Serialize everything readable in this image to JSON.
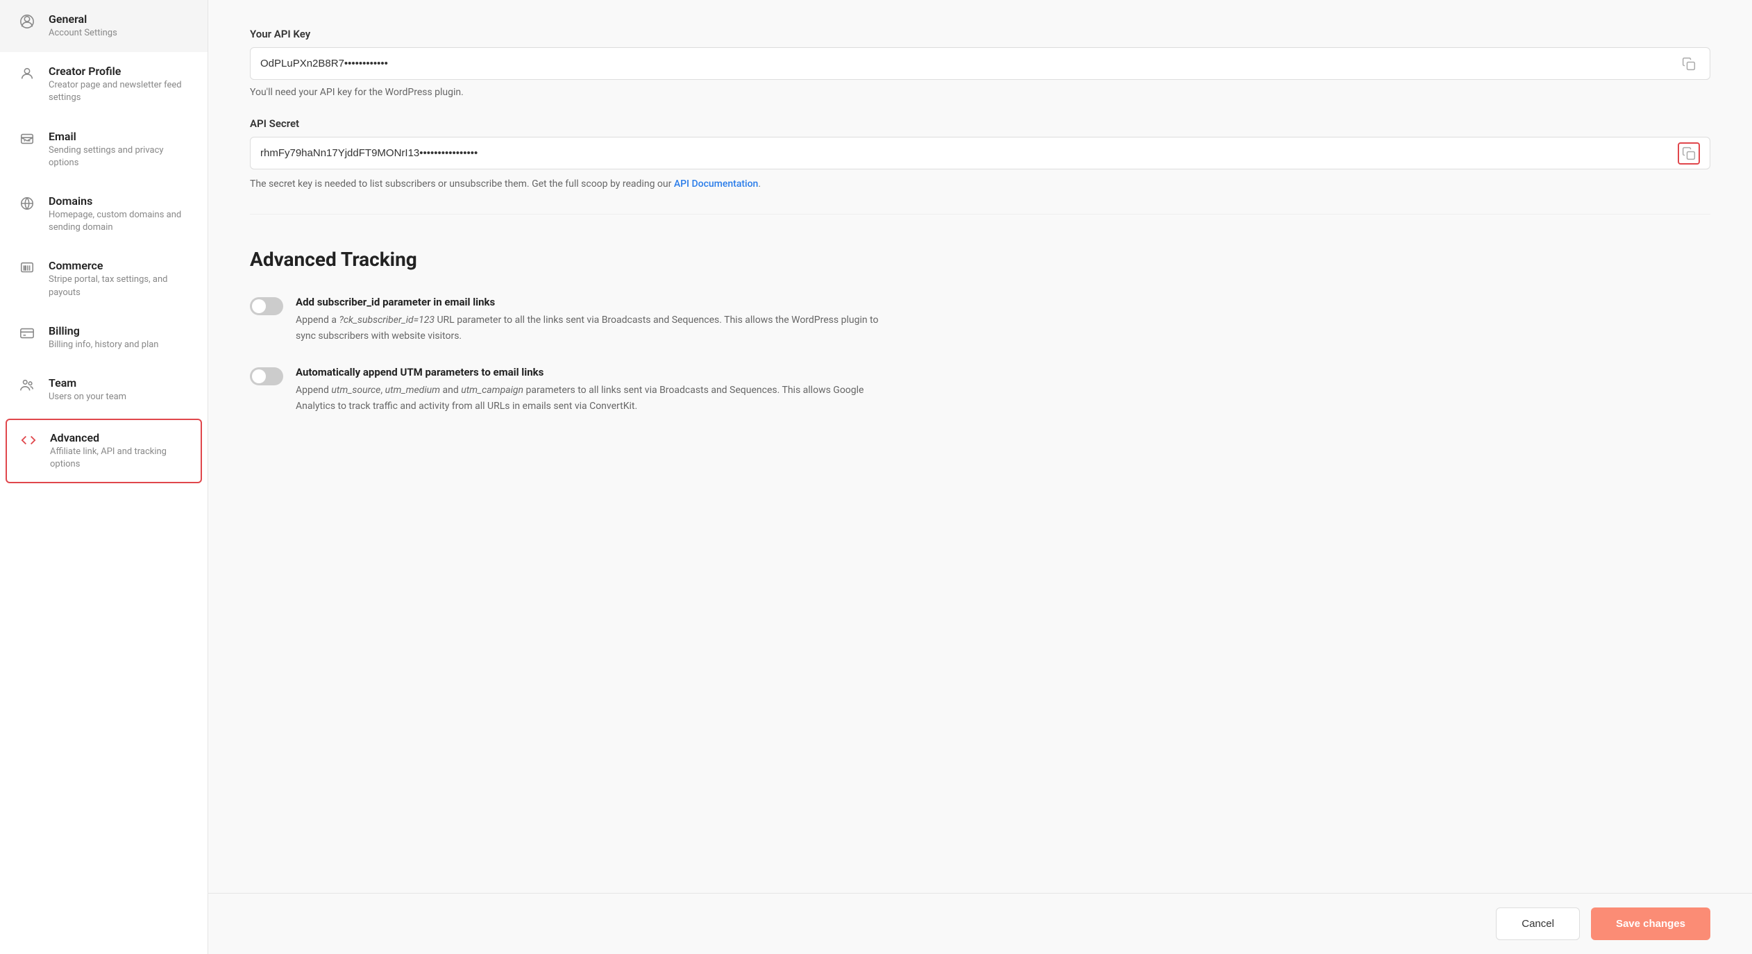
{
  "sidebar": {
    "items": [
      {
        "id": "general",
        "label": "General",
        "sublabel": "Account Settings",
        "icon": "user-circle-icon",
        "active": false
      },
      {
        "id": "creator-profile",
        "label": "Creator Profile",
        "sublabel": "Creator page and newsletter feed settings",
        "icon": "person-icon",
        "active": false
      },
      {
        "id": "email",
        "label": "Email",
        "sublabel": "Sending settings and privacy options",
        "icon": "inbox-icon",
        "active": false
      },
      {
        "id": "domains",
        "label": "Domains",
        "sublabel": "Homepage, custom domains and sending domain",
        "icon": "globe-icon",
        "active": false
      },
      {
        "id": "commerce",
        "label": "Commerce",
        "sublabel": "Stripe portal, tax settings, and payouts",
        "icon": "barcode-icon",
        "active": false
      },
      {
        "id": "billing",
        "label": "Billing",
        "sublabel": "Billing info, history and plan",
        "icon": "card-icon",
        "active": false
      },
      {
        "id": "team",
        "label": "Team",
        "sublabel": "Users on your team",
        "icon": "team-icon",
        "active": false
      },
      {
        "id": "advanced",
        "label": "Advanced",
        "sublabel": "Affiliate link, API and tracking options",
        "icon": "code-icon",
        "active": true
      }
    ]
  },
  "main": {
    "api_key_label": "Your API Key",
    "api_key_value": "OdPLuPXn2B8R7••••••••••••",
    "api_key_helper": "You'll need your API key for the WordPress plugin.",
    "api_secret_label": "API Secret",
    "api_secret_value": "rhmFy79haNn17YjddFT9MONrI13••••••••••••••••",
    "api_secret_helper": "The secret key is needed to list subscribers or unsubscribe them. Get the full scoop by reading our",
    "api_doc_link_text": "API Documentation",
    "api_doc_link_url": "#",
    "advanced_tracking_title": "Advanced Tracking",
    "toggles": [
      {
        "id": "subscriber-id",
        "enabled": false,
        "title": "Add subscriber_id parameter in email links",
        "description": "Append a ?ck_subscriber_id=123 URL parameter to all the links sent via Broadcasts and Sequences. This allows the WordPress plugin to sync subscribers with website visitors."
      },
      {
        "id": "utm-params",
        "enabled": false,
        "title": "Automatically append UTM parameters to email links",
        "description": "Append utm_source, utm_medium and utm_campaign parameters to all links sent via Broadcasts and Sequences. This allows Google Analytics to track traffic and activity from all URLs in emails sent via ConvertKit."
      }
    ],
    "cancel_label": "Cancel",
    "save_label": "Save changes"
  }
}
